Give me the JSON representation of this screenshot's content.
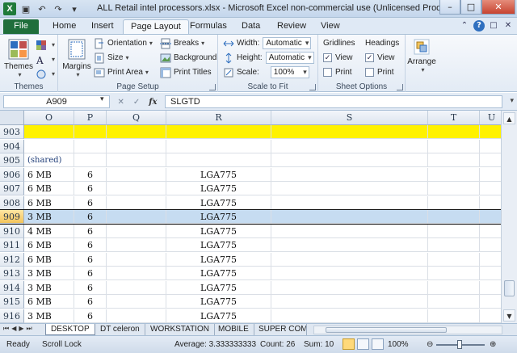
{
  "window": {
    "title": "ALL Retail intel processors.xlsx - Microsoft Excel non-commercial use (Unlicensed Product)",
    "app_letter": "X"
  },
  "ribbon_tabs": [
    "File",
    "Home",
    "Insert",
    "Page Layout",
    "Formulas",
    "Data",
    "Review",
    "View"
  ],
  "active_tab": "Page Layout",
  "ribbon": {
    "themes": {
      "label": "Themes",
      "group_label": "Themes"
    },
    "page_setup": {
      "margins": "Margins",
      "orientation": "Orientation",
      "size": "Size",
      "print_area": "Print Area",
      "breaks": "Breaks",
      "background": "Background",
      "print_titles": "Print Titles",
      "group_label": "Page Setup"
    },
    "scale_to_fit": {
      "width_label": "Width:",
      "width_value": "Automatic",
      "height_label": "Height:",
      "height_value": "Automatic",
      "scale_label": "Scale:",
      "scale_value": "100%",
      "group_label": "Scale to Fit"
    },
    "sheet_options": {
      "gridlines": "Gridlines",
      "headings": "Headings",
      "view": "View",
      "print": "Print",
      "group_label": "Sheet Options"
    },
    "arrange": {
      "label": "Arrange"
    }
  },
  "formula_bar": {
    "name_box": "A909",
    "fx": "fx",
    "value": "SLGTD"
  },
  "columns": [
    "O",
    "P",
    "Q",
    "R",
    "S",
    "T",
    "U"
  ],
  "rows": [
    {
      "num": "903",
      "o": "",
      "p": "",
      "r": "",
      "style": "yellow"
    },
    {
      "num": "904",
      "o": "",
      "p": "",
      "r": "",
      "style": ""
    },
    {
      "num": "905",
      "o": "(shared)",
      "p": "",
      "r": "",
      "style": "shared"
    },
    {
      "num": "906",
      "o": "6 MB",
      "p": "6",
      "r": "LGA775",
      "style": ""
    },
    {
      "num": "907",
      "o": "6 MB",
      "p": "6",
      "r": "LGA775",
      "style": ""
    },
    {
      "num": "908",
      "o": "6 MB",
      "p": "6",
      "r": "LGA775",
      "style": ""
    },
    {
      "num": "909",
      "o": "3 MB",
      "p": "6",
      "r": "LGA775",
      "style": "selected"
    },
    {
      "num": "910",
      "o": "4 MB",
      "p": "6",
      "r": "LGA775",
      "style": ""
    },
    {
      "num": "911",
      "o": "6 MB",
      "p": "6",
      "r": "LGA775",
      "style": ""
    },
    {
      "num": "912",
      "o": "6 MB",
      "p": "6",
      "r": "LGA775",
      "style": ""
    },
    {
      "num": "913",
      "o": "3 MB",
      "p": "6",
      "r": "LGA775",
      "style": ""
    },
    {
      "num": "914",
      "o": "3 MB",
      "p": "6",
      "r": "LGA775",
      "style": ""
    },
    {
      "num": "915",
      "o": "6 MB",
      "p": "6",
      "r": "LGA775",
      "style": ""
    },
    {
      "num": "916",
      "o": "3 MB",
      "p": "6",
      "r": "LGA775",
      "style": ""
    }
  ],
  "sheet_tabs": [
    "DESKTOP",
    "DT celeron",
    "WORKSTATION",
    "MOBILE",
    "SUPER COM"
  ],
  "active_sheet": "DESKTOP",
  "status": {
    "ready": "Ready",
    "scroll_lock": "Scroll Lock",
    "average": "Average: 3.333333333",
    "count": "Count: 26",
    "sum": "Sum: 10",
    "zoom": "100%"
  }
}
